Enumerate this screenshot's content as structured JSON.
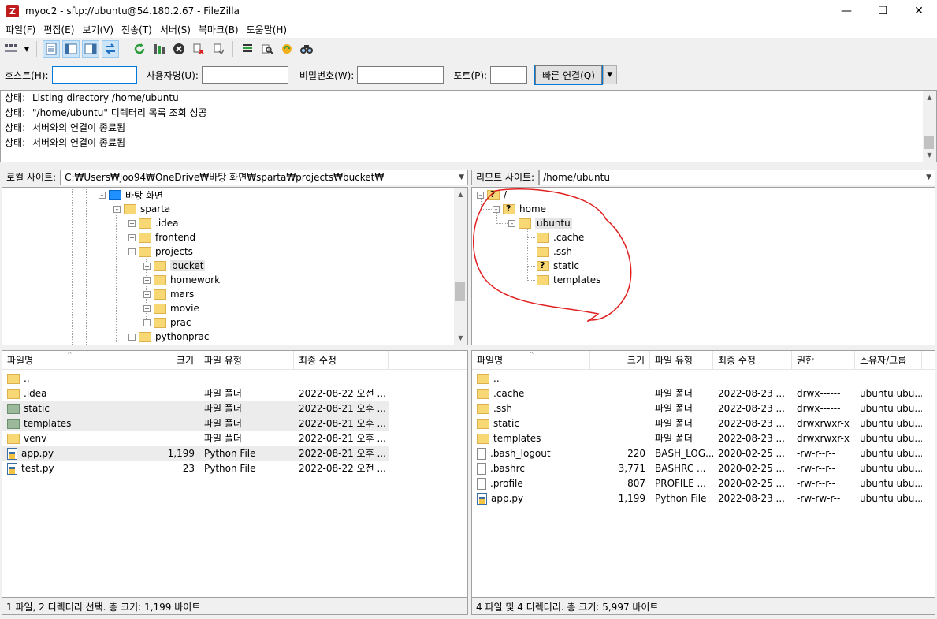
{
  "window": {
    "title": "myoc2 - sftp://ubuntu@54.180.2.67 - FileZilla",
    "minimize": "—",
    "maximize": "☐",
    "close": "✕"
  },
  "menu": [
    "파일(F)",
    "편집(E)",
    "보기(V)",
    "전송(T)",
    "서버(S)",
    "북마크(B)",
    "도움말(H)"
  ],
  "quickconnect": {
    "host_label": "호스트(H):",
    "host_value": "",
    "user_label": "사용자명(U):",
    "user_value": "",
    "pass_label": "비밀번호(W):",
    "pass_value": "",
    "port_label": "포트(P):",
    "port_value": "",
    "button": "빠른 연결(Q)"
  },
  "log": [
    {
      "label": "상태:",
      "text": "Listing directory /home/ubuntu"
    },
    {
      "label": "상태:",
      "text": "\"/home/ubuntu\" 디렉터리 목록 조회 성공"
    },
    {
      "label": "상태:",
      "text": "서버와의 연결이 종료됨"
    },
    {
      "label": "상태:",
      "text": "서버와의 연결이 종료됨"
    }
  ],
  "local": {
    "label": "로컬 사이트:",
    "path": "C:₩Users₩joo94₩OneDrive₩바탕 화면₩sparta₩projects₩bucket₩",
    "tree": [
      "바탕 화면",
      "sparta",
      ".idea",
      "frontend",
      "projects",
      "bucket",
      "homework",
      "mars",
      "movie",
      "prac",
      "pythonprac"
    ],
    "columns": [
      "파일명",
      "크기",
      "파일 유형",
      "최종 수정"
    ],
    "files": [
      {
        "name": "..",
        "size": "",
        "type": "",
        "modified": ""
      },
      {
        "name": ".idea",
        "size": "",
        "type": "파일 폴더",
        "modified": "2022-08-22 오전 ..."
      },
      {
        "name": "static",
        "size": "",
        "type": "파일 폴더",
        "modified": "2022-08-21 오후 ..."
      },
      {
        "name": "templates",
        "size": "",
        "type": "파일 폴더",
        "modified": "2022-08-21 오후 ..."
      },
      {
        "name": "venv",
        "size": "",
        "type": "파일 폴더",
        "modified": "2022-08-21 오후 ..."
      },
      {
        "name": "app.py",
        "size": "1,199",
        "type": "Python File",
        "modified": "2022-08-21 오후 ..."
      },
      {
        "name": "test.py",
        "size": "23",
        "type": "Python File",
        "modified": "2022-08-22 오전 ..."
      }
    ],
    "status": "1 파일, 2 디렉터리 선택. 총 크기: 1,199 바이트"
  },
  "remote": {
    "label": "리모트 사이트:",
    "path": "/home/ubuntu",
    "tree": [
      "/",
      "home",
      "ubuntu",
      ".cache",
      ".ssh",
      "static",
      "templates"
    ],
    "columns": [
      "파일명",
      "크기",
      "파일 유형",
      "최종 수정",
      "권한",
      "소유자/그룹"
    ],
    "files": [
      {
        "name": "..",
        "size": "",
        "type": "",
        "modified": "",
        "perm": "",
        "owner": ""
      },
      {
        "name": ".cache",
        "size": "",
        "type": "파일 폴더",
        "modified": "2022-08-23 ...",
        "perm": "drwx------",
        "owner": "ubuntu ubu..."
      },
      {
        "name": ".ssh",
        "size": "",
        "type": "파일 폴더",
        "modified": "2022-08-23 ...",
        "perm": "drwx------",
        "owner": "ubuntu ubu..."
      },
      {
        "name": "static",
        "size": "",
        "type": "파일 폴더",
        "modified": "2022-08-23 ...",
        "perm": "drwxrwxr-x",
        "owner": "ubuntu ubu..."
      },
      {
        "name": "templates",
        "size": "",
        "type": "파일 폴더",
        "modified": "2022-08-23 ...",
        "perm": "drwxrwxr-x",
        "owner": "ubuntu ubu..."
      },
      {
        "name": ".bash_logout",
        "size": "220",
        "type": "BASH_LOG...",
        "modified": "2020-02-25 ...",
        "perm": "-rw-r--r--",
        "owner": "ubuntu ubu..."
      },
      {
        "name": ".bashrc",
        "size": "3,771",
        "type": "BASHRC ...",
        "modified": "2020-02-25 ...",
        "perm": "-rw-r--r--",
        "owner": "ubuntu ubu..."
      },
      {
        "name": ".profile",
        "size": "807",
        "type": "PROFILE ...",
        "modified": "2020-02-25 ...",
        "perm": "-rw-r--r--",
        "owner": "ubuntu ubu..."
      },
      {
        "name": "app.py",
        "size": "1,199",
        "type": "Python File",
        "modified": "2022-08-23 ...",
        "perm": "-rw-rw-r--",
        "owner": "ubuntu ubu..."
      }
    ],
    "status": "4 파일 및 4 디렉터리. 총 크기: 5,997 바이트"
  },
  "colors": {
    "annotation": "#e02020",
    "folder": "#f8d775",
    "selection": "#cce4f7"
  }
}
